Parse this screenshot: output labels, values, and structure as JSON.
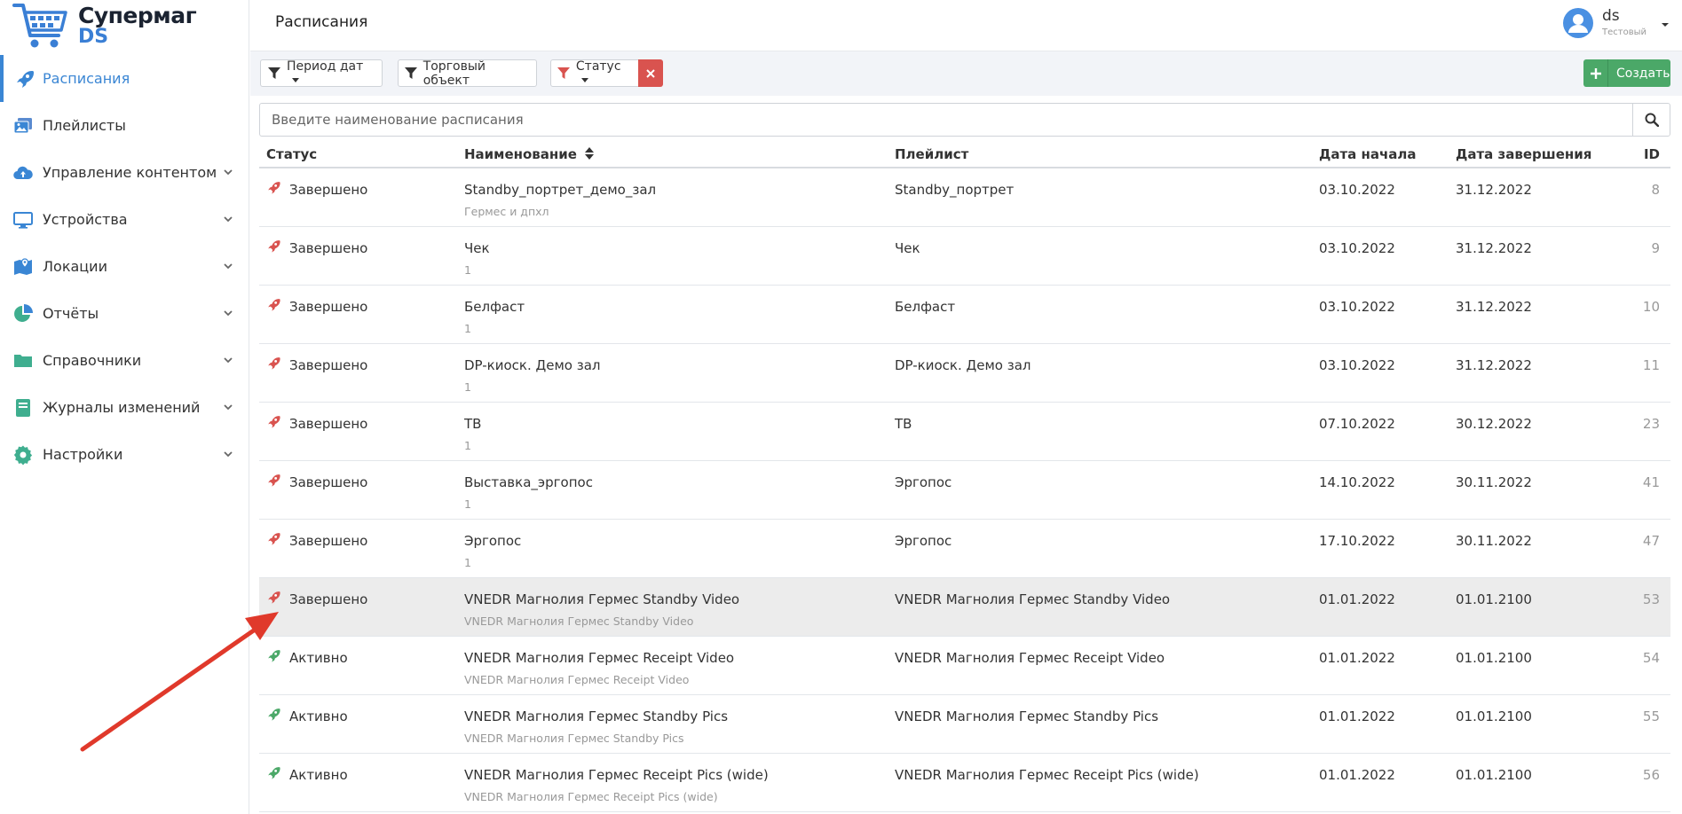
{
  "app": {
    "brand": "Супермаг",
    "brand_sub": "DS"
  },
  "sidebar": {
    "items": [
      {
        "label": "Расписания",
        "icon": "rocket-icon",
        "active": true
      },
      {
        "label": "Плейлисты",
        "icon": "images-icon"
      },
      {
        "label": "Управление контентом",
        "icon": "cloud-upload-icon",
        "expandable": true
      },
      {
        "label": "Устройства",
        "icon": "monitor-icon",
        "expandable": true
      },
      {
        "label": "Локации",
        "icon": "map-marker-icon",
        "expandable": true
      },
      {
        "label": "Отчёты",
        "icon": "pie-chart-icon",
        "expandable": true
      },
      {
        "label": "Справочники",
        "icon": "folder-icon",
        "expandable": true
      },
      {
        "label": "Журналы изменений",
        "icon": "book-icon",
        "expandable": true
      },
      {
        "label": "Настройки",
        "icon": "gear-icon",
        "expandable": true
      }
    ]
  },
  "header": {
    "title": "Расписания",
    "user": {
      "name": "ds",
      "role": "Тестовый"
    }
  },
  "filters": {
    "period": "Период дат",
    "object": "Торговый объект",
    "status": "Статус",
    "create": "Создать"
  },
  "search": {
    "placeholder": "Введите наименование расписания"
  },
  "table": {
    "columns": {
      "status": "Статус",
      "name": "Наименование",
      "playlist": "Плейлист",
      "start": "Дата начала",
      "end": "Дата завершения",
      "id": "ID"
    },
    "rows": [
      {
        "status": "Завершено",
        "state": "done",
        "name": "Standby_портрет_демо_зал",
        "sub": "Гермес и дпхл",
        "playlist": "Standby_портрет",
        "start": "03.10.2022",
        "end": "31.12.2022",
        "id": "8"
      },
      {
        "status": "Завершено",
        "state": "done",
        "name": "Чек",
        "sub": "1",
        "playlist": "Чек",
        "start": "03.10.2022",
        "end": "31.12.2022",
        "id": "9"
      },
      {
        "status": "Завершено",
        "state": "done",
        "name": "Белфаст",
        "sub": "1",
        "playlist": "Белфаст",
        "start": "03.10.2022",
        "end": "31.12.2022",
        "id": "10"
      },
      {
        "status": "Завершено",
        "state": "done",
        "name": "DP-киоск. Демо зал",
        "sub": "1",
        "playlist": "DP-киоск. Демо зал",
        "start": "03.10.2022",
        "end": "31.12.2022",
        "id": "11"
      },
      {
        "status": "Завершено",
        "state": "done",
        "name": "ТВ",
        "sub": "1",
        "playlist": "ТВ",
        "start": "07.10.2022",
        "end": "30.12.2022",
        "id": "23"
      },
      {
        "status": "Завершено",
        "state": "done",
        "name": "Выставка_эргопос",
        "sub": "1",
        "playlist": "Эргопос",
        "start": "14.10.2022",
        "end": "30.11.2022",
        "id": "41"
      },
      {
        "status": "Завершено",
        "state": "done",
        "name": "Эргопос",
        "sub": "1",
        "playlist": "Эргопос",
        "start": "17.10.2022",
        "end": "30.11.2022",
        "id": "47"
      },
      {
        "status": "Завершено",
        "state": "done",
        "highlight": true,
        "name": "VNEDR Магнолия Гермес Standby Video",
        "sub": "VNEDR Магнолия Гермес Standby Video",
        "playlist": "VNEDR Магнолия Гермес Standby Video",
        "start": "01.01.2022",
        "end": "01.01.2100",
        "id": "53"
      },
      {
        "status": "Активно",
        "state": "active",
        "name": "VNEDR Магнолия Гермес Receipt Video",
        "sub": "VNEDR Магнолия Гермес Receipt Video",
        "playlist": "VNEDR Магнолия Гермес Receipt Video",
        "start": "01.01.2022",
        "end": "01.01.2100",
        "id": "54"
      },
      {
        "status": "Активно",
        "state": "active",
        "name": "VNEDR Магнолия Гермес Standby Pics",
        "sub": "VNEDR Магнолия Гермес Standby Pics",
        "playlist": "VNEDR Магнолия Гермес Standby Pics",
        "start": "01.01.2022",
        "end": "01.01.2100",
        "id": "55"
      },
      {
        "status": "Активно",
        "state": "active",
        "name": "VNEDR Магнолия Гермес Receipt Pics (wide)",
        "sub": "VNEDR Магнолия Гермес Receipt Pics (wide)",
        "playlist": "VNEDR Магнолия Гермес Receipt Pics (wide)",
        "start": "01.01.2022",
        "end": "01.01.2100",
        "id": "56"
      }
    ]
  },
  "colors": {
    "accent": "#3a86d4",
    "done": "#d9534f",
    "active": "#4ba868",
    "arrow": "#e0392b"
  }
}
